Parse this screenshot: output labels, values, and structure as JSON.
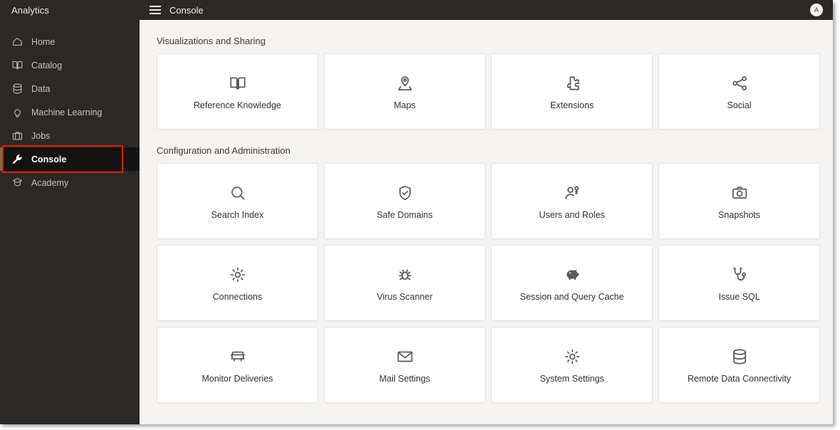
{
  "sidebar": {
    "brand": "Analytics",
    "items": [
      {
        "label": "Home",
        "icon": "home-icon",
        "active": false
      },
      {
        "label": "Catalog",
        "icon": "book-open-icon",
        "active": false
      },
      {
        "label": "Data",
        "icon": "database-icon",
        "active": false
      },
      {
        "label": "Machine Learning",
        "icon": "lightbulb-icon",
        "active": false
      },
      {
        "label": "Jobs",
        "icon": "briefcase-icon",
        "active": false
      },
      {
        "label": "Console",
        "icon": "wrench-icon",
        "active": true
      },
      {
        "label": "Academy",
        "icon": "graduation-cap-icon",
        "active": false
      }
    ],
    "active_accent_color": "#5d7c4b",
    "background_color": "#2b2825"
  },
  "topbar": {
    "menu_icon": "hamburger-icon",
    "title": "Console",
    "avatar_initial": "A"
  },
  "annotation": {
    "target": "Console",
    "color": "#e01b12"
  },
  "main": {
    "sections": [
      {
        "title": "Visualizations and Sharing",
        "cards": [
          {
            "label": "Reference Knowledge",
            "icon": "book-open-icon"
          },
          {
            "label": "Maps",
            "icon": "map-pin-icon"
          },
          {
            "label": "Extensions",
            "icon": "puzzle-piece-icon"
          },
          {
            "label": "Social",
            "icon": "share-nodes-icon"
          }
        ]
      },
      {
        "title": "Configuration and Administration",
        "cards": [
          {
            "label": "Search Index",
            "icon": "magnifier-icon"
          },
          {
            "label": "Safe Domains",
            "icon": "shield-check-icon"
          },
          {
            "label": "Users and Roles",
            "icon": "user-key-icon"
          },
          {
            "label": "Snapshots",
            "icon": "camera-icon"
          },
          {
            "label": "Connections",
            "icon": "gear-icon"
          },
          {
            "label": "Virus Scanner",
            "icon": "bug-icon"
          },
          {
            "label": "Session and Query Cache",
            "icon": "piggy-bank-icon"
          },
          {
            "label": "Issue SQL",
            "icon": "stethoscope-icon"
          },
          {
            "label": "Monitor Deliveries",
            "icon": "delivery-truck-icon"
          },
          {
            "label": "Mail Settings",
            "icon": "envelope-icon"
          },
          {
            "label": "System Settings",
            "icon": "gear-icon"
          },
          {
            "label": "Remote Data Connectivity",
            "icon": "database-icon"
          }
        ]
      }
    ]
  }
}
